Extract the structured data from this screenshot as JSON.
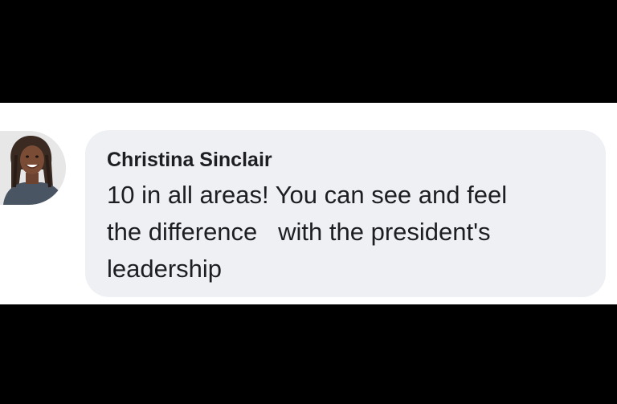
{
  "comment": {
    "author_name": "Christina Sinclair",
    "line1": "10 in all areas! You can see and feel",
    "line2": "the difference   with the president's",
    "line3": "leadership",
    "avatar_icon": "profile-photo",
    "bubble_color": "#eff0f4",
    "text_color": "#1c1e21"
  }
}
